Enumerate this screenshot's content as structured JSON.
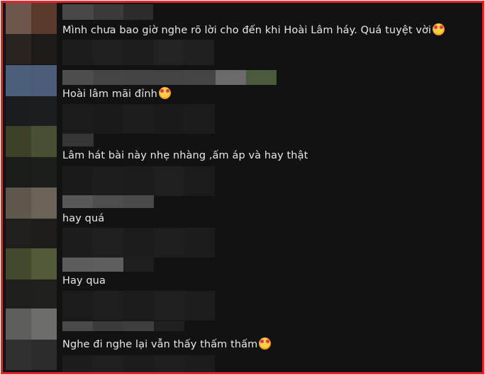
{
  "colors": {
    "frame_border": "#e8232a",
    "background": "#121212",
    "text": "#e8e8e8"
  },
  "comments": [
    {
      "text": "Mình chưa bao giờ nghe rõ lời cho đến khi Hoài Lâm háy. Quá tuyệt vời",
      "emoji": "smiling-face-with-hearts-icon"
    },
    {
      "text": "Hoài lâm mãi đỉnh",
      "emoji": "smiling-face-with-hearts-icon"
    },
    {
      "text": "Lâm hát bài này nhẹ nhàng ,ấm áp và hay thật",
      "emoji": ""
    },
    {
      "text": "hay quá",
      "emoji": ""
    },
    {
      "text": "Hay qua",
      "emoji": ""
    },
    {
      "text": "Nghe đi nghe lại vẫn thấy thấm thấm",
      "emoji": "smiling-face-with-hearts-icon"
    }
  ]
}
